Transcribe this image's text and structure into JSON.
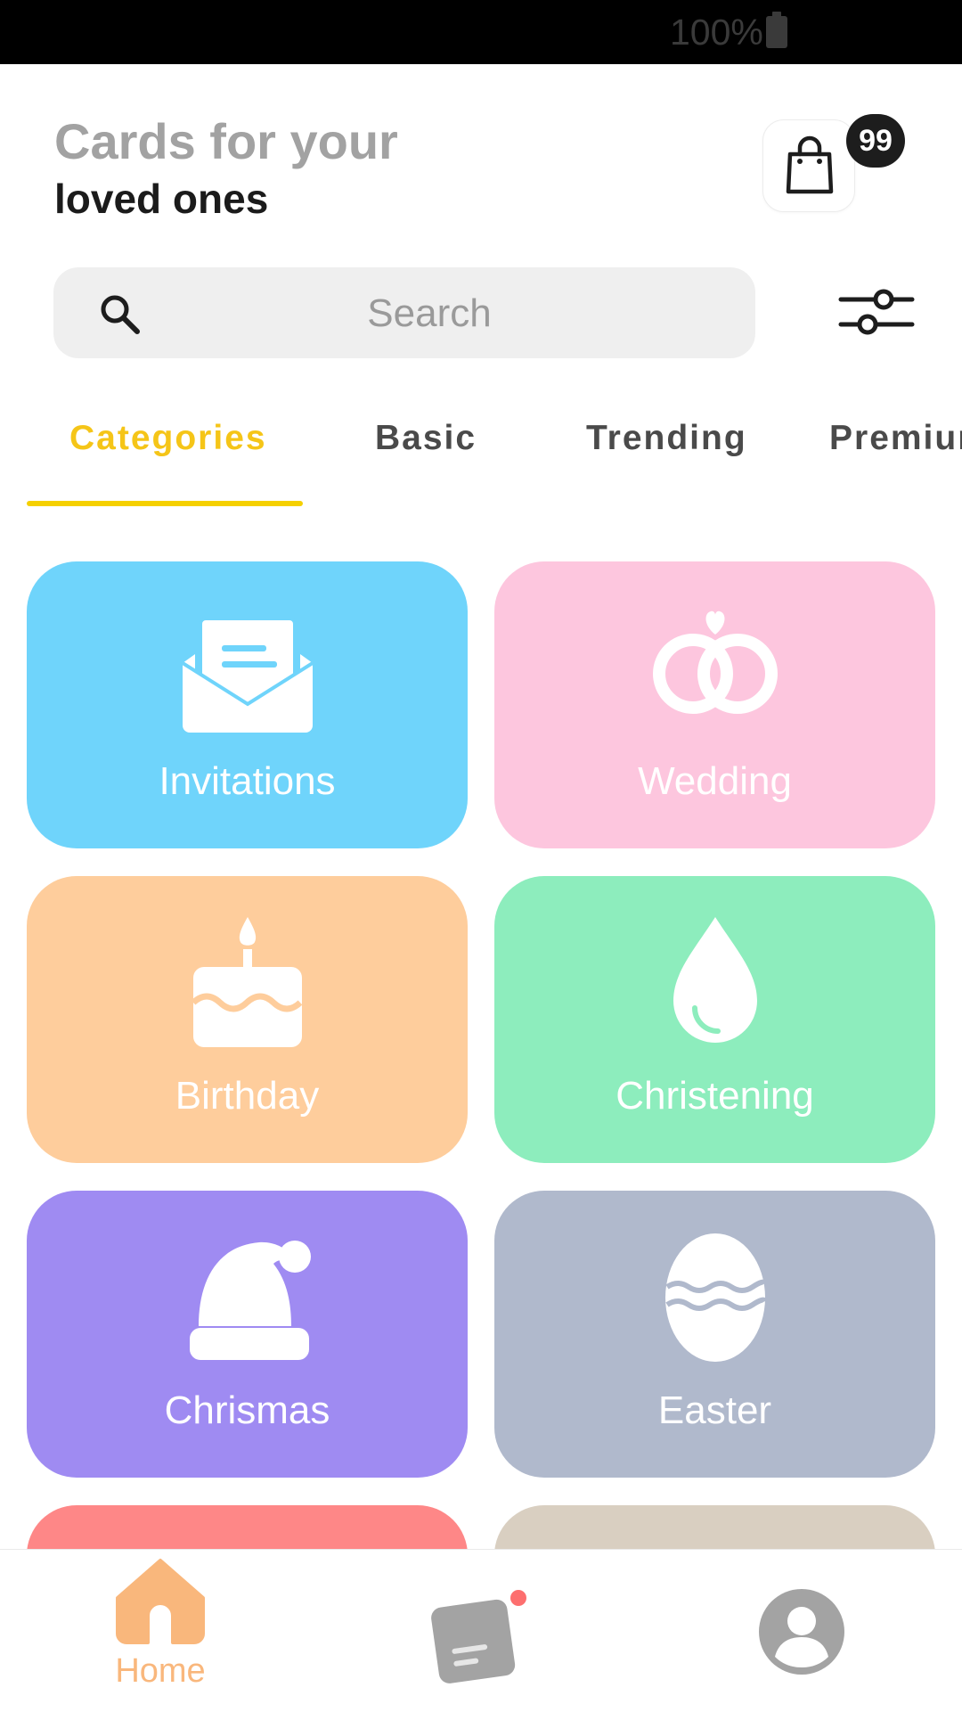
{
  "status_bar": {
    "battery_text": "100%"
  },
  "header": {
    "title": "Cards for your",
    "subtitle": "loved ones",
    "cart_badge": "99"
  },
  "search": {
    "placeholder": "Search",
    "value": ""
  },
  "tabs": [
    {
      "label": "Categories",
      "active": true
    },
    {
      "label": "Basic",
      "active": false
    },
    {
      "label": "Trending",
      "active": false
    },
    {
      "label": "Premium",
      "active": false
    }
  ],
  "categories": [
    {
      "label": "Invitations",
      "icon": "envelope-icon",
      "color": "#6fd4fb"
    },
    {
      "label": "Wedding",
      "icon": "rings-icon",
      "color": "#fdc6de"
    },
    {
      "label": "Birthday",
      "icon": "cake-icon",
      "color": "#fecd9c"
    },
    {
      "label": "Christening",
      "icon": "drop-icon",
      "color": "#8dedbd"
    },
    {
      "label": "Chrismas",
      "icon": "santa-hat-icon",
      "color": "#9f8bf2"
    },
    {
      "label": "Easter",
      "icon": "easter-egg-icon",
      "color": "#b0b9cc"
    },
    {
      "label": "",
      "icon": "",
      "color": "#fe8787"
    },
    {
      "label": "",
      "icon": "",
      "color": "#d9cfc1"
    }
  ],
  "bottom_nav": {
    "home_label": "Home",
    "accent_color": "#f9b77c",
    "notification_color": "#fd6f6f"
  }
}
